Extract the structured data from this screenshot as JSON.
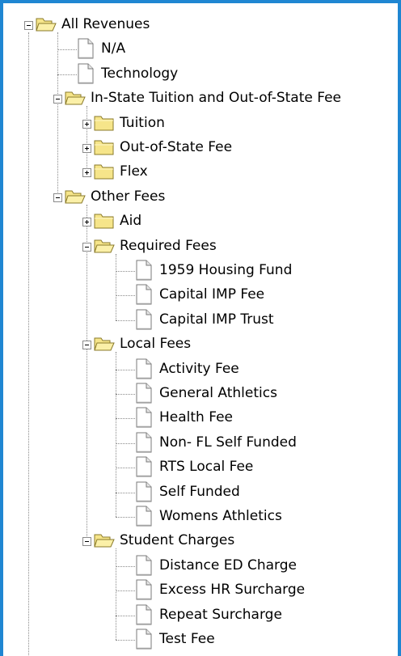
{
  "tree": {
    "label": "All Revenues",
    "type": "folder",
    "state": "expanded",
    "children": [
      {
        "label": "N/A",
        "type": "file"
      },
      {
        "label": "Technology",
        "type": "file"
      },
      {
        "label": "In-State Tuition and Out-of-State Fee",
        "type": "folder",
        "state": "expanded",
        "children": [
          {
            "label": "Tuition",
            "type": "folder",
            "state": "collapsed"
          },
          {
            "label": "Out-of-State Fee",
            "type": "folder",
            "state": "collapsed"
          },
          {
            "label": "Flex",
            "type": "folder",
            "state": "collapsed"
          }
        ]
      },
      {
        "label": "Other Fees",
        "type": "folder",
        "state": "expanded",
        "children": [
          {
            "label": "Aid",
            "type": "folder",
            "state": "collapsed"
          },
          {
            "label": "Required Fees",
            "type": "folder",
            "state": "expanded",
            "children": [
              {
                "label": "1959 Housing Fund",
                "type": "file"
              },
              {
                "label": "Capital IMP Fee",
                "type": "file"
              },
              {
                "label": "Capital IMP Trust",
                "type": "file"
              }
            ]
          },
          {
            "label": "Local Fees",
            "type": "folder",
            "state": "expanded",
            "children": [
              {
                "label": "Activity Fee",
                "type": "file"
              },
              {
                "label": "General Athletics",
                "type": "file"
              },
              {
                "label": "Health Fee",
                "type": "file"
              },
              {
                "label": "Non- FL Self Funded",
                "type": "file"
              },
              {
                "label": "RTS Local Fee",
                "type": "file"
              },
              {
                "label": "Self Funded",
                "type": "file"
              },
              {
                "label": "Womens Athletics",
                "type": "file"
              }
            ]
          },
          {
            "label": "Student Charges",
            "type": "folder",
            "state": "expanded",
            "children": [
              {
                "label": "Distance ED Charge",
                "type": "file"
              },
              {
                "label": "Excess HR Surcharge",
                "type": "file"
              },
              {
                "label": "Repeat Surcharge",
                "type": "file"
              },
              {
                "label": "Test Fee",
                "type": "file"
              }
            ]
          }
        ]
      }
    ]
  },
  "icons": {
    "folder_closed": "folder-icon",
    "folder_open": "folder-open-icon",
    "file": "file-icon",
    "expand": "plus-box-icon",
    "collapse": "minus-box-icon"
  },
  "colors": {
    "frame_border": "#1f86d2",
    "folder_fill": "#f6e58a",
    "folder_stroke": "#8a7a2a"
  }
}
